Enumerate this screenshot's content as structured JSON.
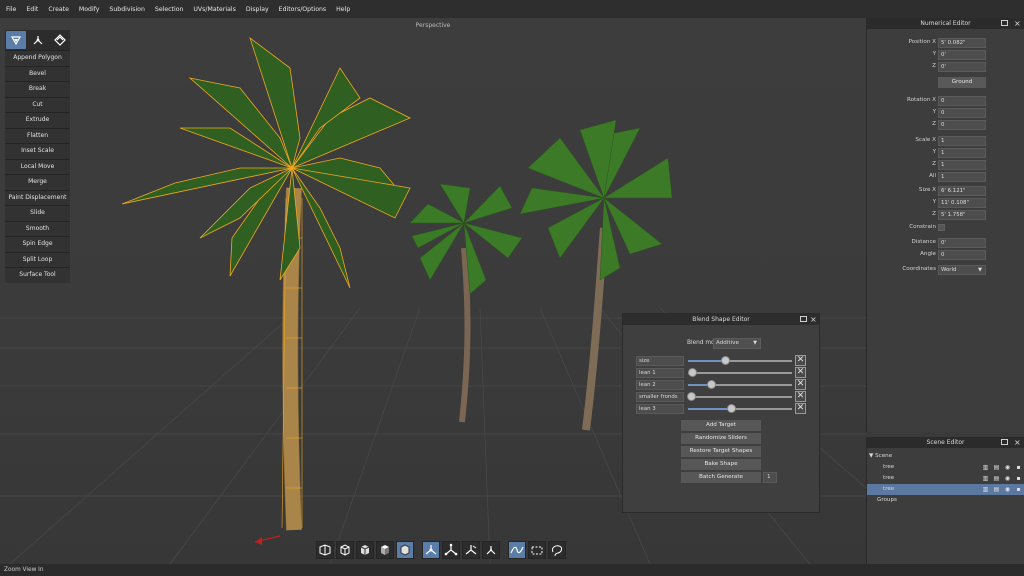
{
  "menu": [
    "File",
    "Edit",
    "Create",
    "Modify",
    "Subdivision",
    "Selection",
    "UVs/Materials",
    "Display",
    "Editors/Options",
    "Help"
  ],
  "viewport": {
    "label": "Perspective"
  },
  "tools": [
    "Append Polygon",
    "Bevel",
    "Break",
    "Cut",
    "Extrude",
    "Flatten",
    "Inset Scale",
    "Local Move",
    "Merge",
    "Paint Displacement",
    "Slide",
    "Smooth",
    "Spin Edge",
    "Split Loop",
    "Surface Tool"
  ],
  "tool_modes": [
    {
      "icon": "face-mode-icon",
      "active": true
    },
    {
      "icon": "vertex-mode-icon",
      "active": false
    },
    {
      "icon": "edge-mode-icon",
      "active": false
    }
  ],
  "numerical_editor": {
    "title": "Numerical Editor",
    "position": {
      "x_label": "Position X",
      "x": "5' 0.082\"",
      "y_label": "Y",
      "y": "0'",
      "z_label": "Z",
      "z": "0'"
    },
    "ground_label": "Ground",
    "rotation": {
      "x_label": "Rotation X",
      "x": "0",
      "y_label": "Y",
      "y": "0",
      "z_label": "Z",
      "z": "0"
    },
    "scale": {
      "x_label": "Scale X",
      "x": "1",
      "y_label": "Y",
      "y": "1",
      "z_label": "Z",
      "z": "1",
      "all_label": "All",
      "all": "1"
    },
    "size": {
      "x_label": "Size X",
      "x": "6' 6.121\"",
      "y_label": "Y",
      "y": "11' 0.108\"",
      "z_label": "Z",
      "z": "5' 1.758\""
    },
    "constrain_label": "Constrain",
    "distance_label": "Distance",
    "distance": "0'",
    "angle_label": "Angle",
    "angle": "0",
    "coordinates_label": "Coordinates",
    "coordinates": "World"
  },
  "scene_editor": {
    "title": "Scene Editor",
    "root": "Scene",
    "items": [
      {
        "name": "tree",
        "selected": false
      },
      {
        "name": "tree",
        "selected": false
      },
      {
        "name": "tree",
        "selected": true
      }
    ],
    "groups_label": "Groups"
  },
  "blend_shape_editor": {
    "title": "Blend Shape Editor",
    "mode_label": "Blend mode",
    "mode": "Additive",
    "sliders": [
      {
        "name": "size",
        "value": 0.36
      },
      {
        "name": "lean 1",
        "value": 0.04
      },
      {
        "name": "lean 2",
        "value": 0.22
      },
      {
        "name": "smaller fronds",
        "value": 0.03
      },
      {
        "name": "lean 3",
        "value": 0.41
      }
    ],
    "buttons": {
      "add_target": "Add Target",
      "randomize": "Randomize Sliders",
      "restore": "Restore Target Shapes",
      "bake": "Bake Shape",
      "batch": "Batch Generate"
    },
    "batch_count": "1"
  },
  "bottom_toolbar": [
    {
      "icon": "perspective-cube-icon",
      "active": false
    },
    {
      "icon": "wire-cube-icon",
      "active": false
    },
    {
      "icon": "solid-cube-icon",
      "active": false
    },
    {
      "icon": "shaded-cube-icon",
      "active": false
    },
    {
      "icon": "textured-cube-icon",
      "active": true
    },
    {
      "icon": "vertex-select-icon",
      "active": true
    },
    {
      "icon": "edge-select-icon",
      "active": false
    },
    {
      "icon": "face-select-icon",
      "active": false
    },
    {
      "icon": "object-select-icon",
      "active": false
    },
    {
      "icon": "freeform-select-icon",
      "active": true
    },
    {
      "icon": "box-select-icon",
      "active": false
    },
    {
      "icon": "lasso-select-icon",
      "active": false
    }
  ],
  "status": "Zoom View In",
  "colors": {
    "accent": "#5a7ea8",
    "wire": "#f0a820",
    "frond": "#3f7a2a",
    "trunk": "#8a7660"
  }
}
